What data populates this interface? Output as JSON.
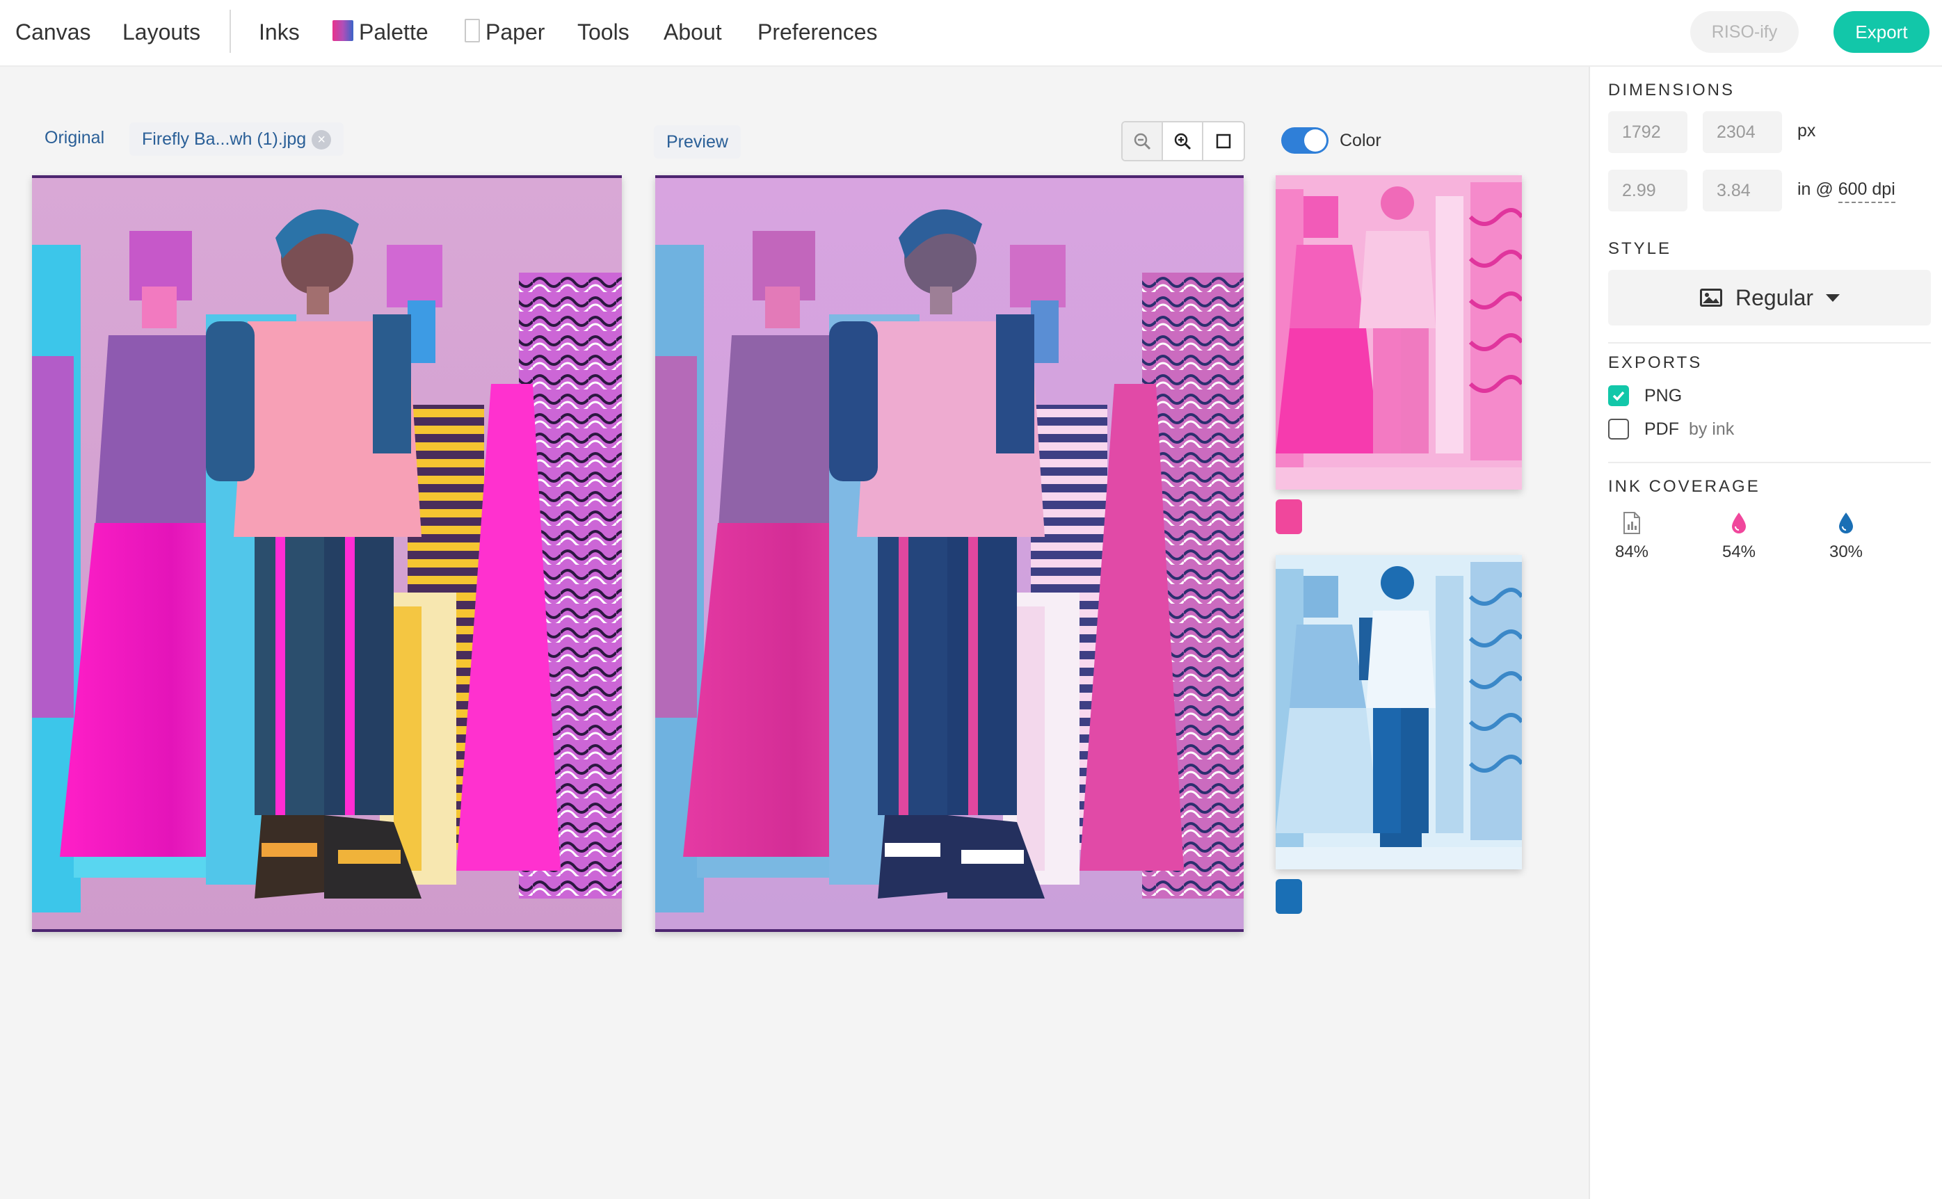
{
  "nav": {
    "items": [
      "Canvas",
      "Layouts",
      "Inks",
      "Palette",
      "Paper",
      "Tools",
      "About",
      "Preferences"
    ],
    "riso_label": "RISO-ify",
    "export_label": "Export",
    "export_color": "#12c7a9"
  },
  "workspace": {
    "original_label": "Original",
    "file_name": "Firefly Ba...wh (1).jpg",
    "preview_label": "Preview",
    "color_toggle_label": "Color",
    "color_toggle_on": true,
    "zoom_tools": [
      "zoom-out-icon",
      "zoom-in-icon",
      "fit-frame-icon"
    ]
  },
  "inks": [
    {
      "name": "pink",
      "color": "#f0479c"
    },
    {
      "name": "blue",
      "color": "#1a6fb5"
    }
  ],
  "panel": {
    "dimensions_title": "DIMENSIONS",
    "width_px": "1792",
    "height_px": "2304",
    "px_unit": "px",
    "width_in": "2.99",
    "height_in": "3.84",
    "in_unit": "in @",
    "dpi": "600 dpi",
    "style_title": "STYLE",
    "style_value": "Regular",
    "exports_title": "EXPORTS",
    "exports": [
      {
        "label": "PNG",
        "note": "",
        "checked": true
      },
      {
        "label": "PDF",
        "note": "by ink",
        "checked": false
      }
    ],
    "coverage_title": "INK COVERAGE",
    "coverage": [
      {
        "icon": "document-icon",
        "value": "84%"
      },
      {
        "icon": "pink-ink-drop-icon",
        "value": "54%",
        "color": "#f0479c"
      },
      {
        "icon": "blue-ink-drop-icon",
        "value": "30%",
        "color": "#1a6fb5"
      }
    ]
  }
}
